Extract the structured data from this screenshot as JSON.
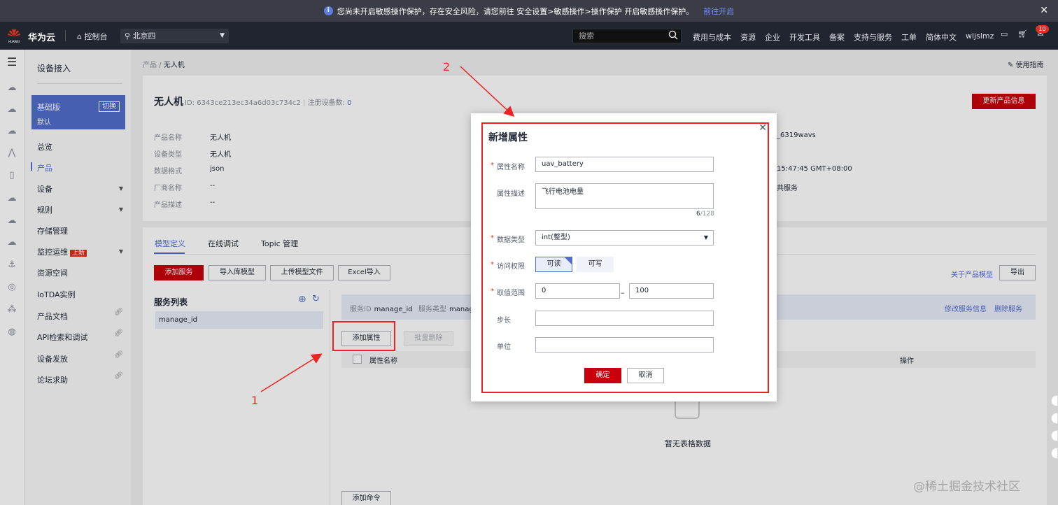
{
  "notice": {
    "text": "您尚未开启敏感操作保护，存在安全风险，请您前往 安全设置>敏感操作>操作保护 开启敏感操作保护。",
    "link": "前往开启"
  },
  "topnav": {
    "brand": "华为云",
    "logo_text": "HUAWEI",
    "console": "控制台",
    "region": "北京四",
    "search_placeholder": "搜索",
    "items": [
      "费用与成本",
      "资源",
      "企业",
      "开发工具",
      "备案",
      "支持与服务",
      "工单",
      "简体中文",
      "wljslmz"
    ],
    "message_badge": "10"
  },
  "sidebar": {
    "title": "设备接入",
    "edition": {
      "name": "基础版",
      "sub": "默认",
      "switch": "切换"
    },
    "items": [
      {
        "label": "总览"
      },
      {
        "label": "产品"
      },
      {
        "label": "设备"
      },
      {
        "label": "规则"
      },
      {
        "label": "存储管理"
      },
      {
        "label": "监控运维"
      },
      {
        "label": "资源空间"
      },
      {
        "label": "IoTDA实例"
      },
      {
        "label": "产品文档"
      },
      {
        "label": "API检索和调试"
      },
      {
        "label": "设备发放"
      },
      {
        "label": "论坛求助"
      }
    ],
    "new_tag": "上新"
  },
  "breadcrumb": {
    "parent": "产品",
    "current": "无人机"
  },
  "guide": "使用指南",
  "product": {
    "name": "无人机",
    "id_label": "ID:",
    "id": "6343ce213ec34a6d03c734c2",
    "registered_label": "注册设备数:",
    "registered": "0",
    "update_button": "更新产品信息",
    "fields": [
      {
        "key": "产品名称",
        "value": "无人机"
      },
      {
        "key": "设备类型",
        "value": "无人机"
      },
      {
        "key": "数据格式",
        "value": "json"
      },
      {
        "key": "厂商名称",
        "value": "--"
      },
      {
        "key": "产品描述",
        "value": "--"
      }
    ],
    "right_values": [
      "_6319wavs",
      "15:47:45 GMT+08:00",
      "共服务"
    ]
  },
  "model": {
    "tabs": [
      "模型定义",
      "在线调试",
      "Topic 管理"
    ],
    "buttons": {
      "add_service": "添加服务",
      "import_model": "导入库模型",
      "upload_model": "上传模型文件",
      "excel_import": "Excel导入",
      "export": "导出"
    },
    "about_link": "关于产品模型",
    "service_list_title": "服务列表",
    "services": [
      "manage_id"
    ],
    "service_info": {
      "id_label": "服务ID",
      "id": "manage_id",
      "type_label": "服务类型",
      "type": "manag"
    },
    "modify_link": "修改服务信息",
    "delete_link": "删除服务",
    "add_property": "添加属性",
    "batch_delete": "批量删除",
    "table_headers": {
      "name": "属性名称",
      "action": "操作"
    },
    "empty_text": "暂无表格数据",
    "add_command": "添加命令"
  },
  "dialog": {
    "title": "新增属性",
    "name_label": "属性名称",
    "name_value": "uav_battery",
    "desc_label": "属性描述",
    "desc_value": "飞行电池电量",
    "desc_count": "6",
    "desc_max": "/128",
    "type_label": "数据类型",
    "type_value": "int(整型)",
    "access_label": "访问权限",
    "access_read": "可读",
    "access_write": "可写",
    "range_label": "取值范围",
    "range_min": "0",
    "range_max": "100",
    "step_label": "步长",
    "step_value": "",
    "unit_label": "单位",
    "unit_value": "",
    "ok": "确定",
    "cancel": "取消"
  },
  "annotations": {
    "one": "1",
    "two": "2"
  },
  "watermark": "@稀土掘金技术社区",
  "colors": {
    "brand_red": "#c7000b",
    "accent_blue": "#526ecc",
    "annotation_red": "#ee2222",
    "nav_bg": "#20252f"
  }
}
